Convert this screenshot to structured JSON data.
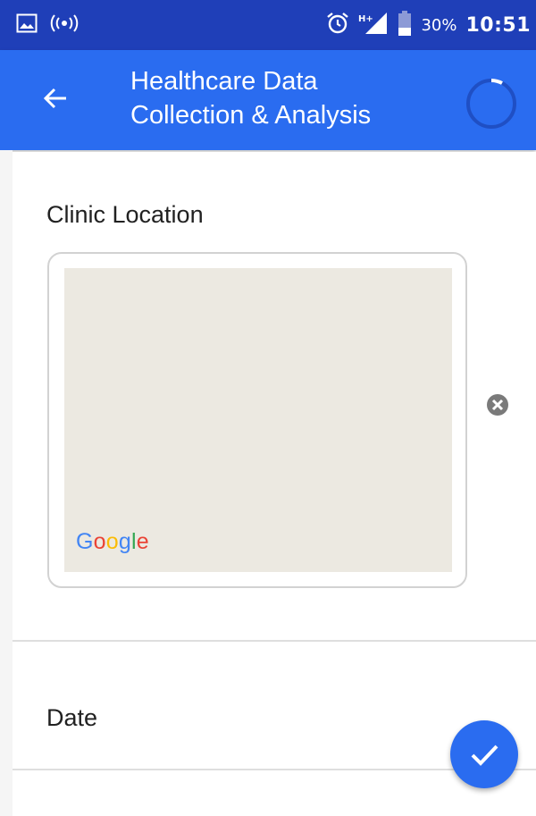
{
  "status_bar": {
    "battery_text": "30%",
    "time": "10:51",
    "icons": [
      "image-notification-icon",
      "hotspot-icon",
      "alarm-icon",
      "signal-icon",
      "battery-icon"
    ]
  },
  "app_bar": {
    "title_line1": "Healthcare Data",
    "title_line2": "Collection & Analysis",
    "back_icon": "arrow-left-icon",
    "progress_icon": "spinner-icon"
  },
  "form": {
    "location_label": "Clinic Location",
    "map_provider": "Google",
    "clear_icon": "clear-circle-icon",
    "date_label": "Date"
  },
  "fab": {
    "icon": "check-icon"
  },
  "colors": {
    "status_bar": "#1f3fb8",
    "app_bar": "#2a6cf0",
    "map_background": "#ece9e1",
    "fab": "#2a6cf0"
  }
}
